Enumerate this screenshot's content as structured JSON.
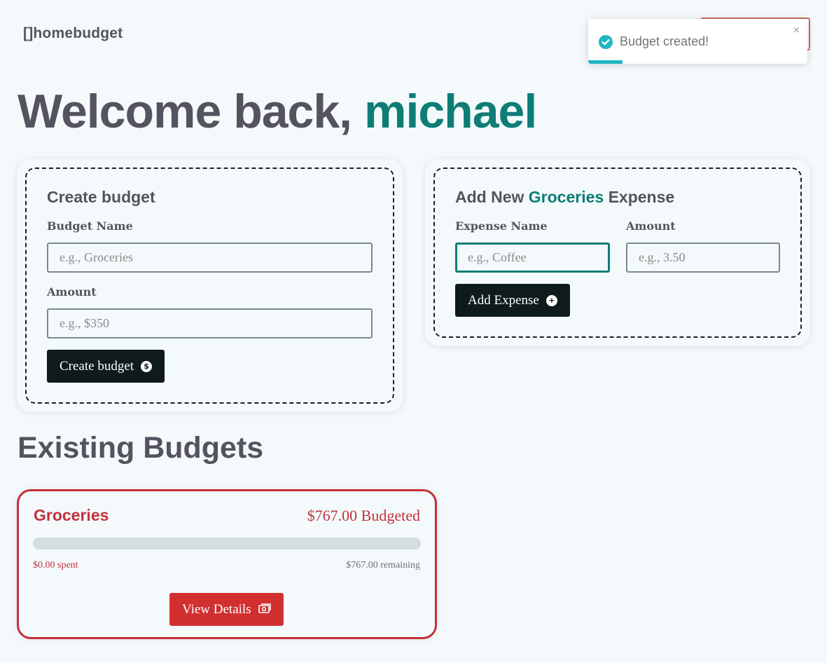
{
  "header": {
    "logo_text": "[]homebudget"
  },
  "toast": {
    "message": "Budget created!",
    "close_symbol": "×",
    "icon": "check-circle-icon",
    "accent_color": "#1fb6c1"
  },
  "welcome": {
    "prefix": "Welcome back, ",
    "username": "michael"
  },
  "create_budget": {
    "title": "Create budget",
    "name_label": "Budget Name",
    "name_placeholder": "e.g., Groceries",
    "amount_label": "Amount",
    "amount_placeholder": "e.g., $350",
    "submit_label": "Create budget",
    "submit_icon": "dollar-circle-icon",
    "submit_icon_glyph": "$"
  },
  "add_expense": {
    "title_prefix": "Add New ",
    "title_budget": "Groceries",
    "title_suffix": " Expense",
    "name_label": "Expense Name",
    "name_placeholder": "e.g., Coffee",
    "amount_label": "Amount",
    "amount_placeholder": "e.g., 3.50",
    "submit_label": "Add Expense",
    "submit_icon": "plus-circle-icon",
    "submit_icon_glyph": "+"
  },
  "existing": {
    "title": "Existing Budgets",
    "budgets": [
      {
        "name": "Groceries",
        "budgeted": "$767.00 Budgeted",
        "spent": "$0.00 spent",
        "remaining": "$767.00 remaining",
        "progress_fraction": 0,
        "color": "#c2303a",
        "button_label": "View Details",
        "button_icon": "banknote-icon"
      }
    ]
  },
  "colors": {
    "background": "#f4fafb",
    "accent": "#0d7d76",
    "text": "#55535f",
    "dark_button": "#0f1a1b",
    "danger": "#d12f30"
  }
}
